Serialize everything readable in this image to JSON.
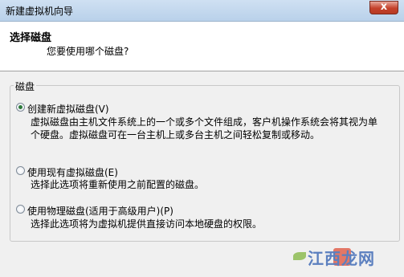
{
  "window": {
    "title": "新建虚拟机向导",
    "close_glyph": "x"
  },
  "header": {
    "title": "选择磁盘",
    "subtitle": "您要使用哪个磁盘?"
  },
  "group": {
    "label": "磁盘"
  },
  "options": [
    {
      "label": "创建新虚拟磁盘(V)",
      "selected": true,
      "desc": [
        "虚拟磁盘由主机文件系统上的一个或多个文件组成，客户机操作系统会将其视为单",
        "个硬盘。虚拟磁盘可在一台主机上或多台主机之间轻松复制或移动。"
      ]
    },
    {
      "label": "使用现有虚拟磁盘(E)",
      "selected": false,
      "desc": [
        "选择此选项将重新使用之前配置的磁盘。"
      ]
    },
    {
      "label": "使用物理磁盘(适用于高级用户)(P)",
      "selected": false,
      "desc": [
        "选择此选项将为虚拟机提供直接访问本地硬盘的权限。"
      ]
    }
  ],
  "watermark": {
    "text": "江西龙网",
    "colors": {
      "text": "#5b7fbf",
      "leaf": "#9cc46a",
      "accent": "#e0614e"
    }
  }
}
